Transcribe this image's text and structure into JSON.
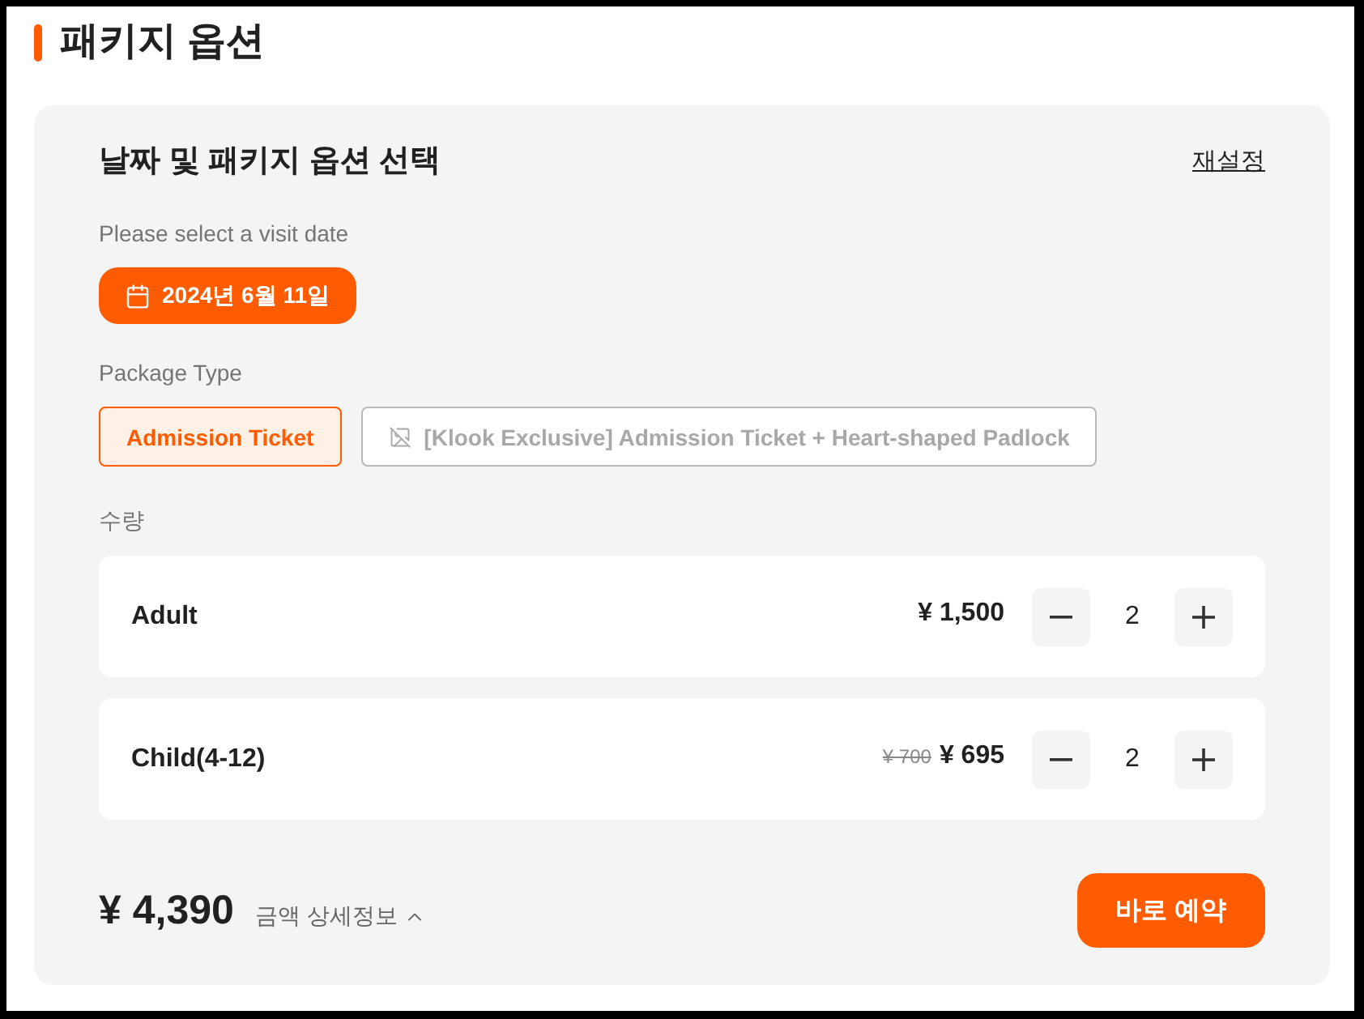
{
  "section_title": "패키지 옵션",
  "panel": {
    "heading": "날짜 및 패키지 옵션 선택",
    "reset_link": "재설정",
    "date": {
      "label": "Please select a visit date",
      "value": "2024년 6월 11일"
    },
    "package": {
      "label": "Package Type",
      "options": [
        {
          "kind": "text",
          "label": "Admission Ticket",
          "selected": true,
          "disabled": false
        },
        {
          "kind": "image",
          "label": "[Klook Exclusive] Admission Ticket + Heart-shaped Padlock",
          "selected": false,
          "disabled": true
        }
      ]
    },
    "quantity": {
      "label": "수량",
      "rows": [
        {
          "name": "Adult",
          "price": "¥ 1,500",
          "quantity": "2"
        },
        {
          "name": "Child(4-12)",
          "original_price": "¥ 700",
          "price": "¥ 695",
          "quantity": "2"
        }
      ]
    },
    "total": {
      "amount": "¥ 4,390",
      "details_toggle": "금액 상세정보"
    },
    "book_button": "바로 예약"
  }
}
